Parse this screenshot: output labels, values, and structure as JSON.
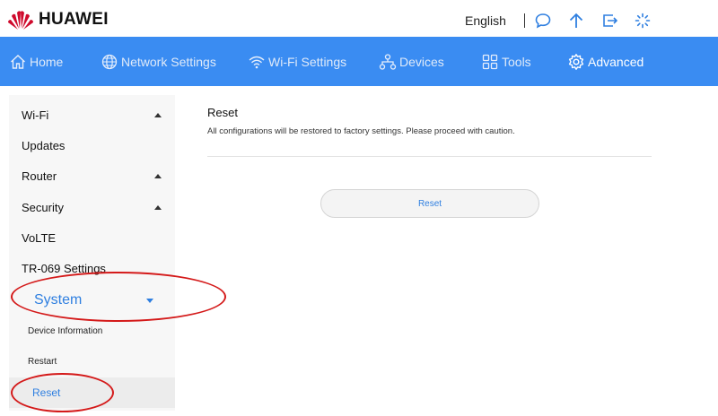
{
  "brand": {
    "name": "HUAWEI"
  },
  "header": {
    "language": "English",
    "icons": [
      "chat-icon",
      "upload-arrow-icon",
      "logout-icon",
      "loading-spinner-icon"
    ]
  },
  "nav": {
    "items": [
      {
        "label": "Home",
        "icon": "home-icon"
      },
      {
        "label": "Network Settings",
        "icon": "globe-icon"
      },
      {
        "label": "Wi-Fi Settings",
        "icon": "wifi-icon"
      },
      {
        "label": "Devices",
        "icon": "devices-icon"
      },
      {
        "label": "Tools",
        "icon": "tools-grid-icon"
      },
      {
        "label": "Advanced",
        "icon": "gear-icon",
        "active": true
      }
    ]
  },
  "sidebar": {
    "items": [
      {
        "label": "Wi-Fi",
        "expandable": true
      },
      {
        "label": "Updates"
      },
      {
        "label": "Router",
        "expandable": true
      },
      {
        "label": "Security",
        "expandable": true
      },
      {
        "label": "VoLTE"
      },
      {
        "label": "TR-069 Settings"
      },
      {
        "label": "System",
        "expanded": true,
        "highlighted": true
      }
    ],
    "system_subitems": [
      {
        "label": "Device Information"
      },
      {
        "label": "Restart"
      },
      {
        "label": "Reset",
        "active": true,
        "highlighted": true
      }
    ]
  },
  "main": {
    "title": "Reset",
    "description": "All configurations will be restored to factory settings. Please proceed with caution.",
    "reset_button": "Reset"
  },
  "colors": {
    "nav_background": "#3a8cf2",
    "accent_blue": "#2f7fe0",
    "annotation_red": "#d41a1a",
    "brand_red": "#cf0a2c"
  }
}
